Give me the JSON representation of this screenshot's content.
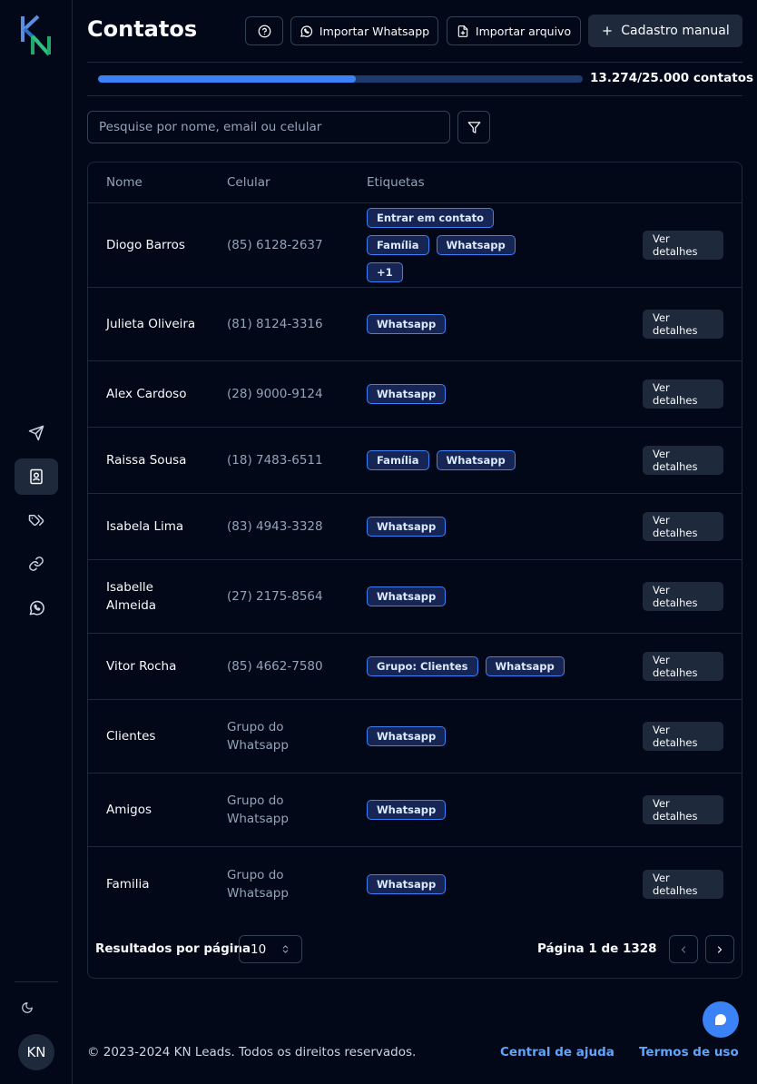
{
  "app": {
    "logo_text": "KN"
  },
  "header": {
    "title": "Contatos",
    "help_icon": "help-circle-icon",
    "import_whatsapp_label": "Importar Whatsapp",
    "import_file_label": "Importar arquivo",
    "manual_label": "Cadastro manual"
  },
  "usage": {
    "used_fraction": 0.531,
    "text": "13.274/25.000 contatos"
  },
  "search": {
    "placeholder": "Pesquise por nome, email ou celular",
    "value": ""
  },
  "table": {
    "headers": {
      "name": "Nome",
      "phone": "Celular",
      "tags": "Etiquetas"
    },
    "action_label": "Ver detalhes",
    "rows": [
      {
        "name": "Diogo Barros",
        "phone": "(85) 6128-2637",
        "tags": [
          "Entrar em contato",
          "Família",
          "Whatsapp",
          "+1"
        ]
      },
      {
        "name": "Julieta Oliveira",
        "phone": "(81) 8124-3316",
        "tags": [
          "Whatsapp"
        ]
      },
      {
        "name": "Alex Cardoso",
        "phone": "(28) 9000-9124",
        "tags": [
          "Whatsapp"
        ]
      },
      {
        "name": "Raissa Sousa",
        "phone": "(18) 7483-6511",
        "tags": [
          "Família",
          "Whatsapp"
        ]
      },
      {
        "name": "Isabela Lima",
        "phone": "(83) 4943-3328",
        "tags": [
          "Whatsapp"
        ]
      },
      {
        "name": "Isabelle Almeida",
        "phone": "(27) 2175-8564",
        "tags": [
          "Whatsapp"
        ]
      },
      {
        "name": "Vitor Rocha",
        "phone": "(85) 4662-7580",
        "tags": [
          "Grupo: Clientes",
          "Whatsapp"
        ]
      },
      {
        "name": "Clientes",
        "phone": "Grupo do Whatsapp",
        "tags": [
          "Whatsapp"
        ]
      },
      {
        "name": "Amigos",
        "phone": "Grupo do Whatsapp",
        "tags": [
          "Whatsapp"
        ]
      },
      {
        "name": "Familia",
        "phone": "Grupo do Whatsapp",
        "tags": [
          "Whatsapp"
        ]
      }
    ]
  },
  "pagination": {
    "per_page_label": "Resultados por página",
    "per_page_value": "10",
    "page_info": "Página 1 de 1328"
  },
  "sidebar": {
    "items": [
      {
        "icon": "send-icon",
        "active": false
      },
      {
        "icon": "contact-book-icon",
        "active": true
      },
      {
        "icon": "tags-icon",
        "active": false
      },
      {
        "icon": "link-icon",
        "active": false
      },
      {
        "icon": "whatsapp-icon",
        "active": false
      }
    ],
    "avatar_initials": "KN"
  },
  "footer": {
    "copyright": "© 2023-2024 KN Leads. Todos os direitos reservados.",
    "help_link": "Central de ajuda",
    "terms_link": "Termos de uso"
  },
  "colors": {
    "accent": "#3b82f6",
    "background": "#020817",
    "tag_bg": "#172554"
  }
}
